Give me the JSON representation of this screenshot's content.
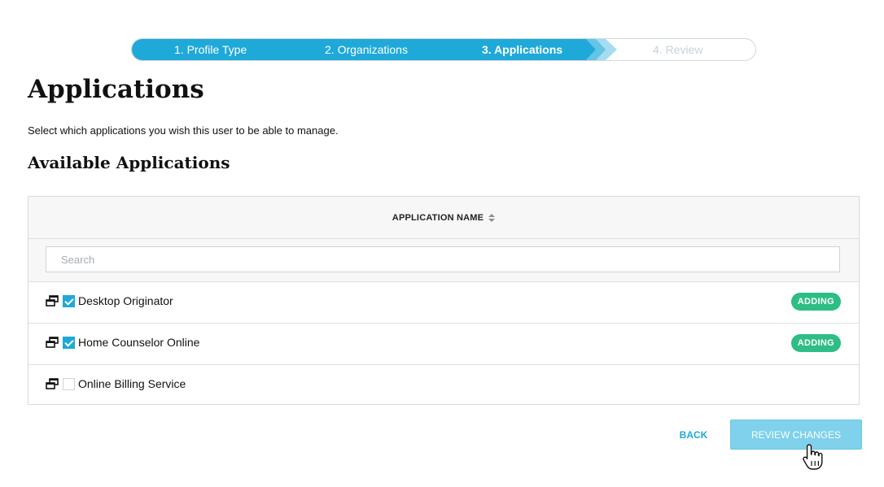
{
  "stepper": {
    "steps": [
      {
        "label": "1. Profile Type",
        "state": "complete"
      },
      {
        "label": "2. Organizations",
        "state": "complete"
      },
      {
        "label": "3. Applications",
        "state": "active"
      },
      {
        "label": "4. Review",
        "state": "pending"
      }
    ]
  },
  "page": {
    "title": "Applications",
    "intro": "Select which applications you wish this user to be able to manage.",
    "section_title": "Available Applications"
  },
  "table": {
    "column_header": "APPLICATION NAME",
    "search_placeholder": "Search",
    "rows": [
      {
        "name": "Desktop Originator",
        "checked": true,
        "badge": "ADDING"
      },
      {
        "name": "Home Counselor Online",
        "checked": true,
        "badge": "ADDING"
      },
      {
        "name": "Online Billing Service",
        "checked": false,
        "badge": ""
      }
    ]
  },
  "actions": {
    "back_label": "BACK",
    "review_label": "REVIEW CHANGES"
  },
  "colors": {
    "accent": "#1fa9d9",
    "badge_green": "#2ebd85",
    "review_button": "#7fd1ec"
  },
  "icons": {
    "row_icon": "windows-restore-icon",
    "sort": "sort-icon",
    "cursor": "hand-pointer-icon"
  }
}
